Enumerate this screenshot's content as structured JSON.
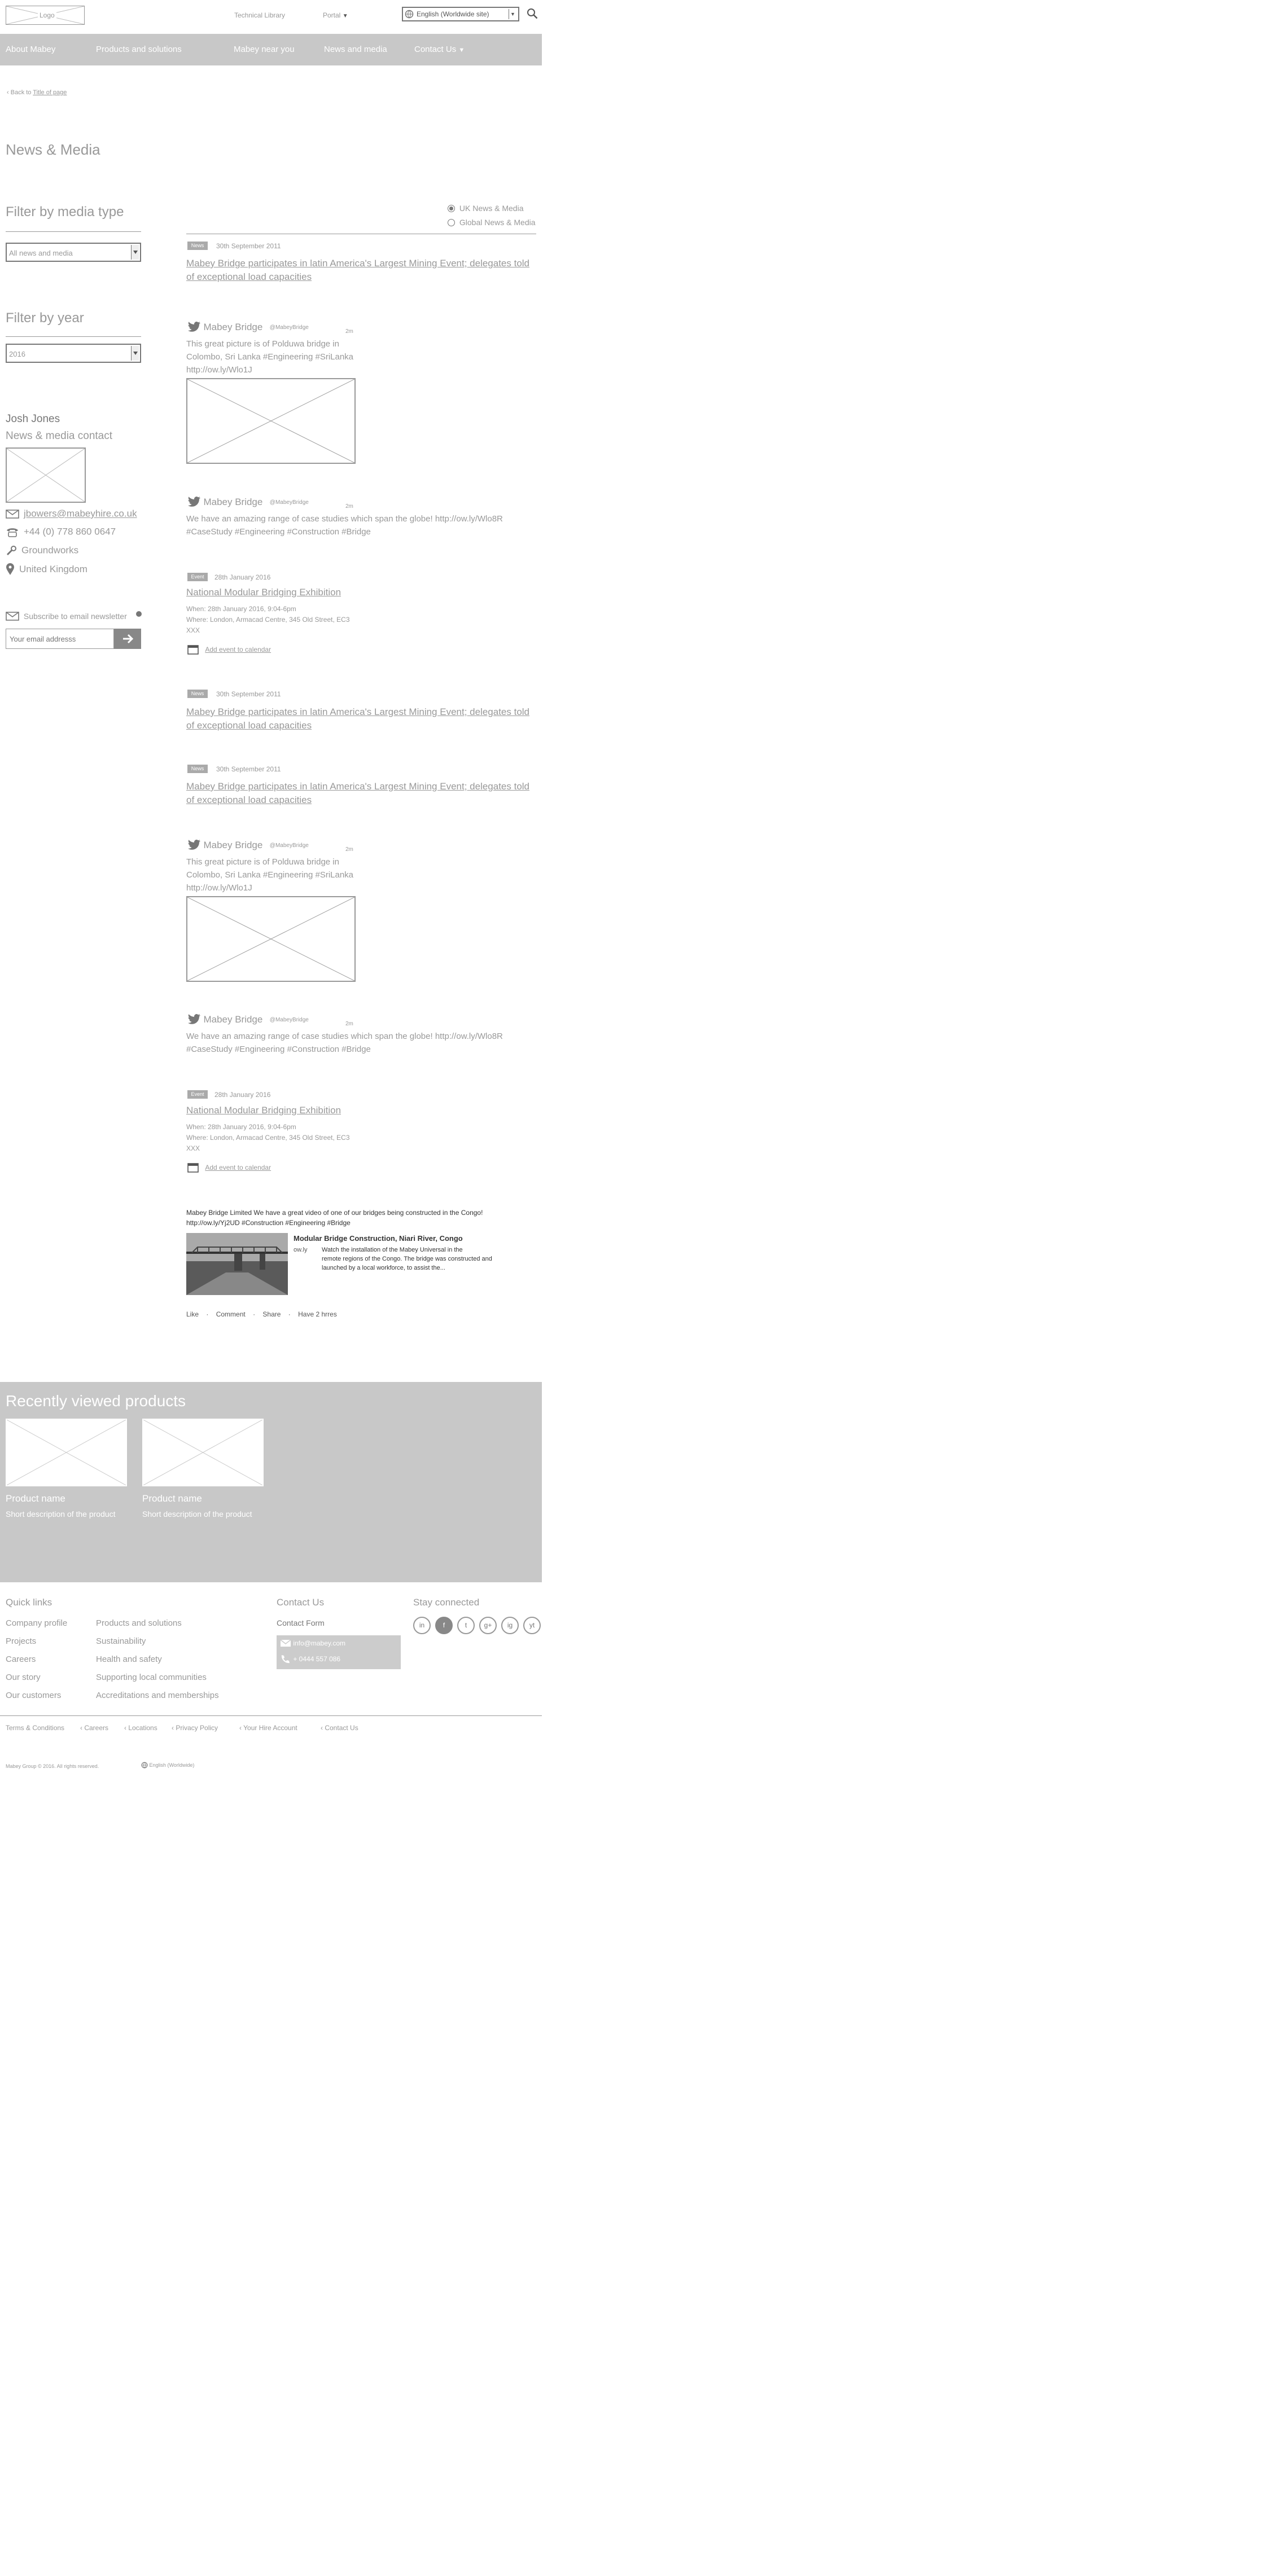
{
  "header": {
    "logo_text": "Logo",
    "technical_library": "Technical Library",
    "portal": "Portal",
    "language": "English (Worldwide site)"
  },
  "nav": [
    "About Mabey",
    "Products and solutions",
    "Mabey near you",
    "News and media",
    "Contact Us"
  ],
  "breadcrumb": {
    "prefix": "Back to",
    "link": "Title of page"
  },
  "page_title": "News & Media",
  "region": {
    "options": [
      "UK News & Media",
      "Global News & Media"
    ],
    "selected": 0
  },
  "filters": {
    "media_title": "Filter by media type",
    "media_value": "All news and media",
    "year_title": "Filter by year",
    "year_value": "2016"
  },
  "contact": {
    "name": "Josh Jones",
    "role": "News & media contact",
    "email": "jbowers@mabeyhire.co.uk",
    "phone": "+44 (0) 778 860 0647",
    "division": "Groundworks",
    "location": "United Kingdom"
  },
  "subscribe": {
    "label": "Subscribe to email newsletter",
    "placeholder": "Your email addresss"
  },
  "feed": {
    "news_tag": "News",
    "event_tag": "Event",
    "news1": {
      "date": "30th September 2011",
      "title": "Mabey Bridge participates in latin America's Largest Mining Event; delegates told of exceptional load capacities"
    },
    "tweet1": {
      "name": "Mabey Bridge",
      "handle": "@MabeyBridge",
      "time": "2m",
      "text": [
        "This great picture is of Polduwa bridge in",
        "Colombo, Sri Lanka #Engineering #SriLanka",
        "http://ow.ly/Wlo1J"
      ]
    },
    "tweet2": {
      "name": "Mabey Bridge",
      "handle": "@MabeyBridge",
      "time": "2m",
      "text": [
        "We have an amazing range of case studies which span the globe! http://ow.ly/Wlo8R",
        "#CaseStudy #Engineering #Construction #Bridge"
      ]
    },
    "event1": {
      "date": "28th January 2016",
      "title": "National Modular Bridging Exhibition",
      "when": "When: 28th January 2016, 9:04-6pm",
      "where": [
        "Where: London, Armacad Centre, 345 Old Street, EC3",
        "XXX"
      ],
      "calendar": "Add event to calendar"
    },
    "news2": {
      "date": "30th September 2011",
      "title": "Mabey Bridge participates in latin America's Largest Mining Event; delegates told of exceptional load capacities"
    },
    "news3": {
      "date": "30th September 2011",
      "title": "Mabey Bridge participates in latin America's Largest Mining Event; delegates told of exceptional load capacities"
    },
    "tweet3": {
      "name": "Mabey Bridge",
      "handle": "@MabeyBridge",
      "time": "2m",
      "text": [
        "This great picture is of Polduwa bridge in",
        "Colombo, Sri Lanka #Engineering #SriLanka",
        "http://ow.ly/Wlo1J"
      ]
    },
    "tweet4": {
      "name": "Mabey Bridge",
      "handle": "@MabeyBridge",
      "time": "2m",
      "text": [
        "We have an amazing range of case studies which span the globe! http://ow.ly/Wlo8R",
        "#CaseStudy #Engineering #Construction #Bridge"
      ]
    },
    "event2": {
      "date": "28th January 2016",
      "title": "National Modular Bridging Exhibition",
      "when": "When: 28th January 2016, 9:04-6pm",
      "where": [
        "Where: London, Armacad Centre, 345 Old Street, EC3",
        "XXX"
      ],
      "calendar": "Add event to calendar"
    },
    "facebook": {
      "post_lines": [
        "Mabey Bridge Limited We have a great video of one of our bridges being constructed in the Congo!",
        "http://ow.ly/Yj2UD #Construction #Engineering #Bridge"
      ],
      "card_title": "Modular Bridge Construction, Niari River, Congo",
      "card_source": "ow.ly",
      "card_text": [
        "Watch the installation of the Mabey Universal in the",
        "remote regions of the Congo. The bridge was constructed and",
        "launched by a local workforce, to assist the..."
      ],
      "actions": [
        "Like",
        "Comment",
        "Share",
        "Have 2 hrres"
      ]
    }
  },
  "recent": {
    "title": "Recently viewed products",
    "products": [
      {
        "name": "Product name",
        "desc": "Short description of the product"
      },
      {
        "name": "Product name",
        "desc": "Short description of the product"
      }
    ]
  },
  "footer": {
    "quick_links_title": "Quick links",
    "col1": [
      "Company profile",
      "Projects",
      "Careers",
      "Our story",
      "Our customers"
    ],
    "col2": [
      "Products and solutions",
      "Sustainability",
      "Health and safety",
      "Supporting local communities",
      "Accreditations and memberships"
    ],
    "contact_title": "Contact Us",
    "contact_form": "Contact Form",
    "contact_email": "info@mabey.com",
    "contact_phone": "+ 0444 557 086",
    "stay_title": "Stay connected",
    "social": [
      "in",
      "f",
      "t",
      "g+",
      "ig",
      "yt"
    ],
    "bottom": [
      "Terms & Conditions",
      "Careers",
      "Locations",
      "Privacy Policy",
      "Your Hire Account",
      "Contact Us"
    ],
    "copyright": "Mabey Group © 2016. All rights reserved.",
    "lang": "English (Worldwide)"
  }
}
